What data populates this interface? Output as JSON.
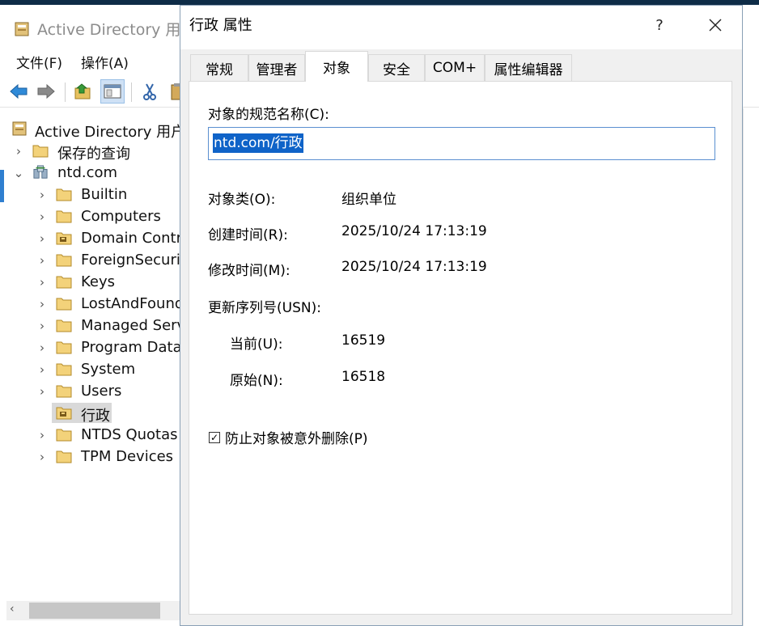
{
  "aduc_window": {
    "title": "Active Directory 用户",
    "menu": [
      "文件(F)",
      "操作(A)"
    ],
    "toolbar": [
      "back-arrow-icon",
      "forward-arrow-icon",
      "up-folder-icon",
      "show-hide-tree-icon",
      "cut-icon",
      "clipboard-icon"
    ],
    "tree": {
      "root": "Active Directory 用户和",
      "items": [
        {
          "label": "保存的查询",
          "level": 1,
          "expand": ">",
          "icon": "folder-icon"
        },
        {
          "label": "ntd.com",
          "level": 1,
          "expand": "v",
          "icon": "domain-icon"
        },
        {
          "label": "Builtin",
          "level": 2,
          "expand": ">",
          "icon": "folder-icon"
        },
        {
          "label": "Computers",
          "level": 2,
          "expand": ">",
          "icon": "folder-icon"
        },
        {
          "label": "Domain Controllers",
          "level": 2,
          "expand": ">",
          "icon": "ou-icon"
        },
        {
          "label": "ForeignSecurityPrincipals",
          "level": 2,
          "expand": ">",
          "icon": "folder-icon"
        },
        {
          "label": "Keys",
          "level": 2,
          "expand": ">",
          "icon": "folder-icon"
        },
        {
          "label": "LostAndFound",
          "level": 2,
          "expand": ">",
          "icon": "folder-icon"
        },
        {
          "label": "Managed Service Accounts",
          "level": 2,
          "expand": ">",
          "icon": "folder-icon"
        },
        {
          "label": "Program Data",
          "level": 2,
          "expand": ">",
          "icon": "folder-icon"
        },
        {
          "label": "System",
          "level": 2,
          "expand": ">",
          "icon": "folder-icon"
        },
        {
          "label": "Users",
          "level": 2,
          "expand": ">",
          "icon": "folder-icon"
        },
        {
          "label": "行政",
          "level": 2,
          "expand": "",
          "icon": "ou-icon",
          "selected": true
        },
        {
          "label": "NTDS Quotas",
          "level": 2,
          "expand": ">",
          "icon": "folder-icon"
        },
        {
          "label": "TPM Devices",
          "level": 2,
          "expand": ">",
          "icon": "folder-icon"
        }
      ]
    }
  },
  "dialog": {
    "title": "行政 属性",
    "help_label": "?",
    "tabs": [
      "常规",
      "管理者",
      "对象",
      "安全",
      "COM+",
      "属性编辑器"
    ],
    "active_tab": "对象",
    "canonical_name_label": "对象的规范名称(C):",
    "canonical_name_value": "ntd.com/行政",
    "object_class_label": "对象类(O):",
    "object_class_value": "组织单位",
    "created_label": "创建时间(R):",
    "created_value": "2025/10/24 17:13:19",
    "modified_label": "修改时间(M):",
    "modified_value": "2025/10/24 17:13:19",
    "usn_label": "更新序列号(USN):",
    "usn_current_label": "当前(U):",
    "usn_current_value": "16519",
    "usn_original_label": "原始(N):",
    "usn_original_value": "16518",
    "protect_checkbox_label": "防止对象被意外删除(P)",
    "protect_checked": true,
    "check_mark": "✓"
  }
}
